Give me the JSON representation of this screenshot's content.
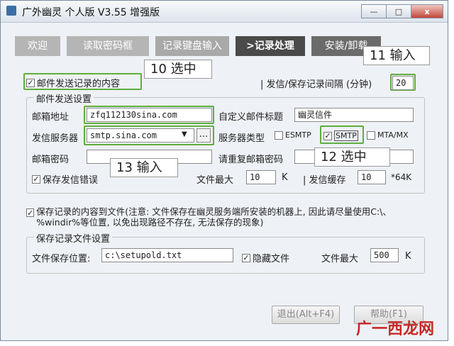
{
  "window": {
    "title": "广外幽灵 个人版 V3.55 增强版",
    "minimize": "—",
    "maximize": "□",
    "close": "x"
  },
  "tabs": [
    {
      "label": "欢迎"
    },
    {
      "label": "读取密码框"
    },
    {
      "label": "记录键盘输入"
    },
    {
      "label": ">记录处理"
    },
    {
      "label": "安装/卸载"
    }
  ],
  "mail_record": {
    "checkbox_label": "邮件发送记录的内容",
    "checked": true,
    "interval_label": "| 发信/保存记录间隔 (分钟)",
    "interval_value": "20"
  },
  "mail_settings": {
    "legend": "邮件发送设置",
    "address_label": "邮箱地址",
    "address_value": "zfq112130sina.com",
    "custom_title_label": "自定义邮件标题",
    "custom_title_value": "幽灵信件",
    "server_label": "发信服务器",
    "server_value": "smtp.sina.com",
    "server_dropdown": "▼",
    "server_browse": "...",
    "server_type_label": "服务器类型",
    "esmtp_label": "ESMTP",
    "esmtp_checked": false,
    "smtp_label": "SMTP",
    "smtp_checked": true,
    "mta_label": "MTA/MX",
    "mta_checked": false,
    "password_label": "邮箱密码",
    "password_value": "",
    "repeat_password_label": "请重复邮箱密码",
    "repeat_password_value": "",
    "save_error_label": "保存发信错误",
    "save_error_checked": true,
    "file_max_label": "文件最大",
    "file_max_value": "10",
    "file_max_unit": "K",
    "send_buffer_label": "| 发信缓存",
    "send_buffer_value": "10",
    "send_buffer_unit": "*64K"
  },
  "save_record": {
    "checkbox_label": "保存记录的内容到文件(注意: 文件保存在幽灵服务端所安装的机器上, 因此请尽量使用C:\\、%windir%等位置, 以免出现路径不存在, 无法保存的现象)",
    "checked": true
  },
  "file_settings": {
    "legend": "保存记录文件设置",
    "location_label": "文件保存位置:",
    "location_value": "c:\\setupold.txt",
    "hidden_label": "隐藏文件",
    "hidden_checked": true,
    "max_label": "文件最大",
    "max_value": "500",
    "max_unit": "K"
  },
  "buttons": {
    "exit": "退出(Alt+F4)",
    "help": "帮助(F1)"
  },
  "callouts": {
    "c10": "10 选中",
    "c11": "11 输入",
    "c12": "12 选中",
    "c13": "13 输入"
  },
  "watermark": "广一西龙网"
}
